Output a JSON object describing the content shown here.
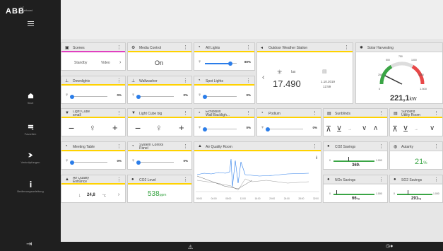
{
  "sidebar": {
    "logo": "ABB",
    "logo_sub": [
      "IoT",
      "Dashboard"
    ],
    "nav": [
      {
        "label": "Start"
      },
      {
        "label": "Favoriten"
      },
      {
        "label": "Verknüpfungen"
      },
      {
        "label": "Bedienungsanleitung"
      }
    ]
  },
  "tiles": {
    "scenes": {
      "title": "Scenes",
      "btn1": "Standby",
      "btn2": "Video",
      "arrow": "›"
    },
    "media": {
      "title": "Media Control",
      "state": "On"
    },
    "all_lights": {
      "title": "All Lights",
      "pct": "80%",
      "level": 0.8
    },
    "weather": {
      "title": "Outdoor Weather Station",
      "unit": "lux",
      "value": "17.490",
      "date": "1.10.2019",
      "time": "12:59"
    },
    "solar": {
      "title": "Solar Harvesting",
      "value": "221,1",
      "unit": "kW",
      "scale_min": "0",
      "scale_max": "1.500",
      "ticks": [
        "250",
        "500",
        "750",
        "1000",
        "1250"
      ],
      "level": 0.147
    },
    "downlights": {
      "title": "Downlights",
      "pct": "0%",
      "level": 0
    },
    "wallwasher": {
      "title": "Wallwasher",
      "pct": "0%",
      "level": 0
    },
    "spotlights": {
      "title": "Spot Lights",
      "pct": "0%",
      "level": 0
    },
    "lightcube_small": {
      "title": "Light Cube\nsmall",
      "minus": "−",
      "plus": "+"
    },
    "lightcube_big": {
      "title": "Light Cube big",
      "minus": "−",
      "plus": "+"
    },
    "exhibition": {
      "title": "Exhibition\nWall Backligh...",
      "pct": "0%",
      "level": 0
    },
    "podium": {
      "title": "Podium",
      "pct": "0%",
      "level": 0
    },
    "sunblinds": {
      "title": "Sunblinds"
    },
    "sunblind_utility": {
      "title": "Sunblind\nUtility Room"
    },
    "meeting_table": {
      "title": "Meeting Table",
      "pct": "0%",
      "level": 0
    },
    "system_control": {
      "title": "System Control\nPanel",
      "pct": "0%",
      "level": 0
    },
    "air_quality_room": {
      "title": "Air Quality Room",
      "info": "i",
      "x_labels": [
        "00:00",
        "04:00",
        "08:00",
        "12:00",
        "16:00",
        "20:00",
        "24:00",
        "28:00",
        "32:00"
      ]
    },
    "co2_savings": {
      "title": "CO2 Savings",
      "value": "369",
      "unit": "t",
      "scale_min": "0",
      "scale_max": "1.000",
      "level": 0.369
    },
    "autarky": {
      "title": "Autarky",
      "value": "21",
      "unit": "%"
    },
    "air_quality_entrance": {
      "title": "Air Quality\nEntrance",
      "temp": "24,8",
      "temp_unit": "°C",
      "arrow": "›"
    },
    "co2_level": {
      "title": "CO2 Level",
      "value": "538",
      "unit": "ppm"
    },
    "nox_savings": {
      "title": "NOx Savings",
      "value": "66",
      "unit": "kg",
      "scale_min": "0",
      "scale_max": "1.000",
      "level": 0.066
    },
    "so2_savings": {
      "title": "SO2 Savings",
      "value": "291",
      "unit": "kg",
      "scale_min": "0",
      "scale_max": "1.000",
      "level": 0.291
    }
  },
  "colors": {
    "accent_yellow": "#ffd200",
    "accent_magenta": "#e040c0",
    "blue": "#2b7de9",
    "green": "#3aa545",
    "sidebar": "#1f1f1f"
  },
  "icons": [
    "hamburger-icon",
    "home-icon",
    "favorites-icon",
    "link-icon",
    "info-icon",
    "logout-icon",
    "warning-icon",
    "clock-icon",
    "kebab-menu-icon",
    "bulb-icon",
    "sun-icon",
    "blinds-icon",
    "leaf-icon",
    "gauge-icon",
    "building-icon"
  ]
}
